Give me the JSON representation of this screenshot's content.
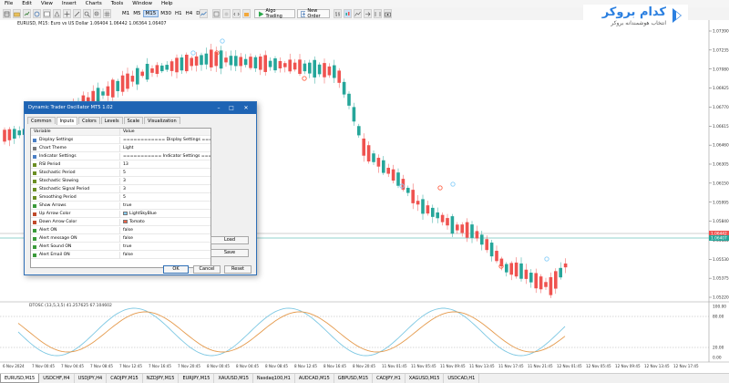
{
  "menu": [
    "File",
    "Edit",
    "View",
    "Insert",
    "Charts",
    "Tools",
    "Window",
    "Help"
  ],
  "toolbar": {
    "timeframes": [
      "M1",
      "M5",
      "M15",
      "M30",
      "H1",
      "H4",
      "D1"
    ],
    "active_timeframe": "M15",
    "algo_trading_label": "Algo Trading",
    "new_order_label": "New Order"
  },
  "chart": {
    "title": "EURUSD, M15: Euro vs US Dollar 1.06404 1.06442 1.06364 1.06407",
    "price_labels": [
      "1.07390",
      "1.07235",
      "1.07080",
      "1.06925",
      "1.06770",
      "1.06615",
      "1.06460",
      "1.06305",
      "1.06150",
      "1.05995",
      "1.05840",
      "1.05685",
      "1.05530",
      "1.05375",
      "1.05220"
    ],
    "current_price": "1.06407",
    "bid_price": "1.06442",
    "time_labels": [
      "6 Nov 2024",
      "7 Nov 00:45",
      "7 Nov 04:45",
      "7 Nov 08:45",
      "7 Nov 12:45",
      "7 Nov 16:45",
      "7 Nov 20:45",
      "8 Nov 00:45",
      "8 Nov 04:45",
      "8 Nov 08:45",
      "8 Nov 12:45",
      "8 Nov 16:45",
      "8 Nov 20:45",
      "11 Nov 01:45",
      "11 Nov 05:45",
      "11 Nov 09:45",
      "11 Nov 13:45",
      "11 Nov 17:45",
      "11 Nov 21:45",
      "12 Nov 01:45",
      "12 Nov 05:45",
      "12 Nov 09:45",
      "12 Nov 13:45",
      "12 Nov 17:45"
    ],
    "colors": {
      "bull": "#26a69a",
      "bear": "#ef5350"
    }
  },
  "oscillator": {
    "title": "DTOSC (13,5,3,5) 41.257625 67.104602",
    "levels": [
      "100.00",
      "80.00",
      "20.00",
      "0.00"
    ],
    "colors": {
      "fast": "#7ec8e3",
      "slow": "#e59a4c"
    }
  },
  "logo": {
    "name": "کدام بروکر",
    "tagline": "انتخاب هوشمندانه بروکر",
    "color": "#2a7fe0"
  },
  "dialog": {
    "title": "Dynamic Trader Oscillator MT5 1.02",
    "tabs": [
      "Common",
      "Inputs",
      "Colors",
      "Levels",
      "Scale",
      "Visualization"
    ],
    "active_tab": "Inputs",
    "header": {
      "variable": "Variable",
      "value": "Value"
    },
    "rows": [
      {
        "icon": "abc",
        "name": "Display Settings",
        "value": "============ Display Settings ======"
      },
      {
        "icon": "list",
        "name": "Chart Theme",
        "value": "Light"
      },
      {
        "icon": "abc",
        "name": "Indicator Settings",
        "value": "=========== Indicator Settings ======"
      },
      {
        "icon": "num",
        "name": "RSI Period",
        "value": "13"
      },
      {
        "icon": "num",
        "name": "Stochastic Period",
        "value": "5"
      },
      {
        "icon": "num",
        "name": "Stochastic Slowing",
        "value": "3"
      },
      {
        "icon": "num",
        "name": "Stochastic Signal Period",
        "value": "3"
      },
      {
        "icon": "num",
        "name": "Smoothing Period",
        "value": "5"
      },
      {
        "icon": "bool",
        "name": "Show Arrows",
        "value": "true"
      },
      {
        "icon": "color",
        "name": "Up Arrow Color",
        "value": "LightSkyBlue",
        "swatch": "#87cefa"
      },
      {
        "icon": "color",
        "name": "Down Arrow Color",
        "value": "Tomato",
        "swatch": "#ff6347"
      },
      {
        "icon": "bool",
        "name": "Alert ON",
        "value": "false"
      },
      {
        "icon": "bool",
        "name": "Alert message ON",
        "value": "false"
      },
      {
        "icon": "bool",
        "name": "Alert Sound ON",
        "value": "true"
      },
      {
        "icon": "bool",
        "name": "Alert Email ON",
        "value": "false"
      }
    ],
    "load_label": "Load",
    "save_label": "Save",
    "ok_label": "OK",
    "cancel_label": "Cancel",
    "reset_label": "Reset"
  },
  "symbol_tabs": [
    "EURUSD,M15",
    "USDCHF,H4",
    "USDJPY,H4",
    "CADJPY,M15",
    "NZDJPY,M15",
    "EURJPY,M15",
    "XAUUSD,M15",
    "Nasdaq100,H1",
    "AUDCAD,M15",
    "GBPUSD,M15",
    "CADJPY,H1",
    "XAGUSD,M15",
    "USDCAD,H1"
  ],
  "active_symbol_tab": "EURUSD,M15"
}
